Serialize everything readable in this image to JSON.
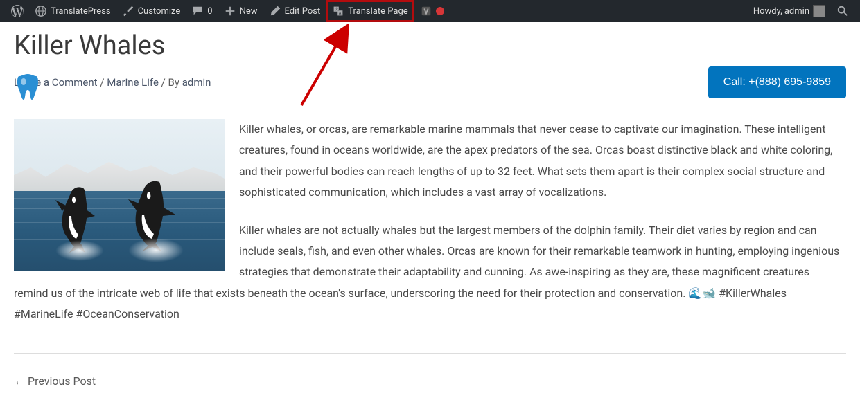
{
  "admin_bar": {
    "translatepress": "TranslatePress",
    "customize": "Customize",
    "comments_count": "0",
    "new": "New",
    "edit_post": "Edit Post",
    "translate_page": "Translate Page",
    "howdy": "Howdy, admin"
  },
  "page": {
    "title": "Killer Whales",
    "meta": {
      "leave_comment": "Leave a Comment",
      "sep1": " / ",
      "category": "Marine Life",
      "sep2": " / By ",
      "author": "admin"
    },
    "call_button": "Call: +(888) 695-9859"
  },
  "article": {
    "p1": "Killer whales, or orcas, are remarkable marine mammals that never cease to captivate our imagination. These intelligent creatures, found in oceans worldwide, are the apex predators of the sea. Orcas boast distinctive black and white coloring, and their powerful bodies can reach lengths of up to 32 feet. What sets them apart is their complex social structure and sophisticated communication, which includes a vast array of vocalizations.",
    "p2": "Killer whales are not actually whales but the largest members of the dolphin family. Their diet varies by region and can include seals, fish, and even other whales. Orcas are known for their remarkable teamwork in hunting, employing ingenious strategies that demonstrate their adaptability and cunning. As awe-inspiring as they are, these magnificent creatures remind us of the intricate web of life that exists beneath the ocean's surface, underscoring the need for their protection and conservation. 🌊🐋 #KillerWhales #MarineLife #OceanConservation"
  },
  "nav": {
    "prev": "← Previous Post"
  }
}
